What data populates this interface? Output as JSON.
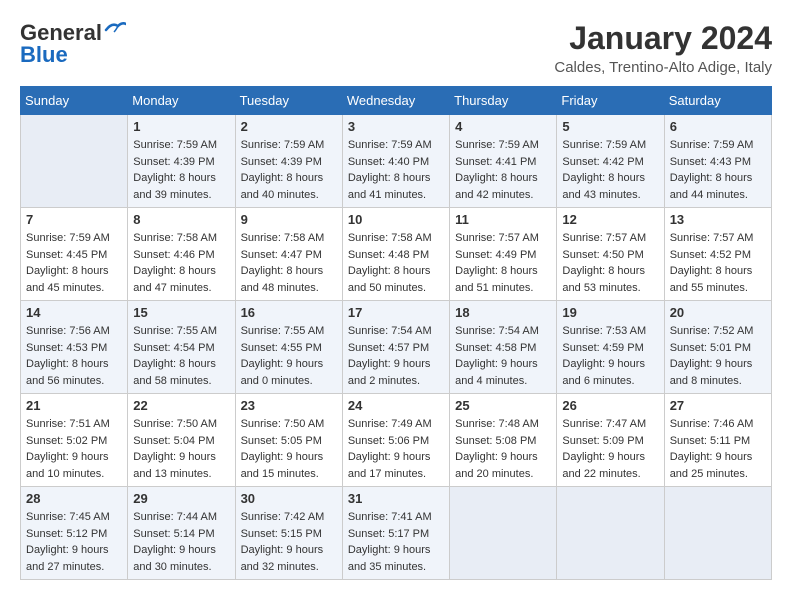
{
  "header": {
    "logo_line1": "General",
    "logo_line2": "Blue",
    "month_year": "January 2024",
    "location": "Caldes, Trentino-Alto Adige, Italy"
  },
  "weekdays": [
    "Sunday",
    "Monday",
    "Tuesday",
    "Wednesday",
    "Thursday",
    "Friday",
    "Saturday"
  ],
  "weeks": [
    [
      {
        "day": null,
        "info": null
      },
      {
        "day": "1",
        "info": "Sunrise: 7:59 AM\nSunset: 4:39 PM\nDaylight: 8 hours\nand 39 minutes."
      },
      {
        "day": "2",
        "info": "Sunrise: 7:59 AM\nSunset: 4:39 PM\nDaylight: 8 hours\nand 40 minutes."
      },
      {
        "day": "3",
        "info": "Sunrise: 7:59 AM\nSunset: 4:40 PM\nDaylight: 8 hours\nand 41 minutes."
      },
      {
        "day": "4",
        "info": "Sunrise: 7:59 AM\nSunset: 4:41 PM\nDaylight: 8 hours\nand 42 minutes."
      },
      {
        "day": "5",
        "info": "Sunrise: 7:59 AM\nSunset: 4:42 PM\nDaylight: 8 hours\nand 43 minutes."
      },
      {
        "day": "6",
        "info": "Sunrise: 7:59 AM\nSunset: 4:43 PM\nDaylight: 8 hours\nand 44 minutes."
      }
    ],
    [
      {
        "day": "7",
        "info": "Sunrise: 7:59 AM\nSunset: 4:45 PM\nDaylight: 8 hours\nand 45 minutes."
      },
      {
        "day": "8",
        "info": "Sunrise: 7:58 AM\nSunset: 4:46 PM\nDaylight: 8 hours\nand 47 minutes."
      },
      {
        "day": "9",
        "info": "Sunrise: 7:58 AM\nSunset: 4:47 PM\nDaylight: 8 hours\nand 48 minutes."
      },
      {
        "day": "10",
        "info": "Sunrise: 7:58 AM\nSunset: 4:48 PM\nDaylight: 8 hours\nand 50 minutes."
      },
      {
        "day": "11",
        "info": "Sunrise: 7:57 AM\nSunset: 4:49 PM\nDaylight: 8 hours\nand 51 minutes."
      },
      {
        "day": "12",
        "info": "Sunrise: 7:57 AM\nSunset: 4:50 PM\nDaylight: 8 hours\nand 53 minutes."
      },
      {
        "day": "13",
        "info": "Sunrise: 7:57 AM\nSunset: 4:52 PM\nDaylight: 8 hours\nand 55 minutes."
      }
    ],
    [
      {
        "day": "14",
        "info": "Sunrise: 7:56 AM\nSunset: 4:53 PM\nDaylight: 8 hours\nand 56 minutes."
      },
      {
        "day": "15",
        "info": "Sunrise: 7:55 AM\nSunset: 4:54 PM\nDaylight: 8 hours\nand 58 minutes."
      },
      {
        "day": "16",
        "info": "Sunrise: 7:55 AM\nSunset: 4:55 PM\nDaylight: 9 hours\nand 0 minutes."
      },
      {
        "day": "17",
        "info": "Sunrise: 7:54 AM\nSunset: 4:57 PM\nDaylight: 9 hours\nand 2 minutes."
      },
      {
        "day": "18",
        "info": "Sunrise: 7:54 AM\nSunset: 4:58 PM\nDaylight: 9 hours\nand 4 minutes."
      },
      {
        "day": "19",
        "info": "Sunrise: 7:53 AM\nSunset: 4:59 PM\nDaylight: 9 hours\nand 6 minutes."
      },
      {
        "day": "20",
        "info": "Sunrise: 7:52 AM\nSunset: 5:01 PM\nDaylight: 9 hours\nand 8 minutes."
      }
    ],
    [
      {
        "day": "21",
        "info": "Sunrise: 7:51 AM\nSunset: 5:02 PM\nDaylight: 9 hours\nand 10 minutes."
      },
      {
        "day": "22",
        "info": "Sunrise: 7:50 AM\nSunset: 5:04 PM\nDaylight: 9 hours\nand 13 minutes."
      },
      {
        "day": "23",
        "info": "Sunrise: 7:50 AM\nSunset: 5:05 PM\nDaylight: 9 hours\nand 15 minutes."
      },
      {
        "day": "24",
        "info": "Sunrise: 7:49 AM\nSunset: 5:06 PM\nDaylight: 9 hours\nand 17 minutes."
      },
      {
        "day": "25",
        "info": "Sunrise: 7:48 AM\nSunset: 5:08 PM\nDaylight: 9 hours\nand 20 minutes."
      },
      {
        "day": "26",
        "info": "Sunrise: 7:47 AM\nSunset: 5:09 PM\nDaylight: 9 hours\nand 22 minutes."
      },
      {
        "day": "27",
        "info": "Sunrise: 7:46 AM\nSunset: 5:11 PM\nDaylight: 9 hours\nand 25 minutes."
      }
    ],
    [
      {
        "day": "28",
        "info": "Sunrise: 7:45 AM\nSunset: 5:12 PM\nDaylight: 9 hours\nand 27 minutes."
      },
      {
        "day": "29",
        "info": "Sunrise: 7:44 AM\nSunset: 5:14 PM\nDaylight: 9 hours\nand 30 minutes."
      },
      {
        "day": "30",
        "info": "Sunrise: 7:42 AM\nSunset: 5:15 PM\nDaylight: 9 hours\nand 32 minutes."
      },
      {
        "day": "31",
        "info": "Sunrise: 7:41 AM\nSunset: 5:17 PM\nDaylight: 9 hours\nand 35 minutes."
      },
      {
        "day": null,
        "info": null
      },
      {
        "day": null,
        "info": null
      },
      {
        "day": null,
        "info": null
      }
    ]
  ]
}
